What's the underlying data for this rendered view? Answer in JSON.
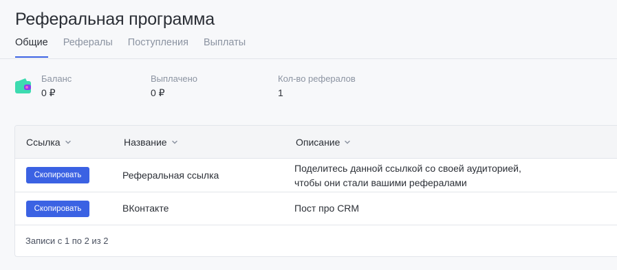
{
  "page": {
    "title": "Реферальная программа"
  },
  "tabs": [
    {
      "label": "Общие",
      "active": true
    },
    {
      "label": "Рефералы",
      "active": false
    },
    {
      "label": "Поступления",
      "active": false
    },
    {
      "label": "Выплаты",
      "active": false
    }
  ],
  "stats": {
    "wallet_icon": "wallet-icon",
    "balance": {
      "label": "Баланс",
      "value": "0 ₽"
    },
    "paid": {
      "label": "Выплачено",
      "value": "0 ₽"
    },
    "referrals": {
      "label": "Кол-во рефералов",
      "value": "1"
    }
  },
  "table": {
    "columns": [
      "Ссылка",
      "Название",
      "Описание"
    ],
    "rows": [
      {
        "button": "Скопировать",
        "name": "Реферальная ссылка",
        "description_line1": "Поделитесь данной ссылкой со своей аудиторией,",
        "description_line2": "чтобы они стали вашими рефералами"
      },
      {
        "button": "Скопировать",
        "name": "ВКонтакте",
        "description_line1": "Пост про CRM"
      }
    ],
    "footer": "Записи с 1 по 2 из 2"
  },
  "colors": {
    "accent": "#3b62e3",
    "wallet": "#3ddbb0",
    "wallet_clasp": "#8b3cf0"
  }
}
